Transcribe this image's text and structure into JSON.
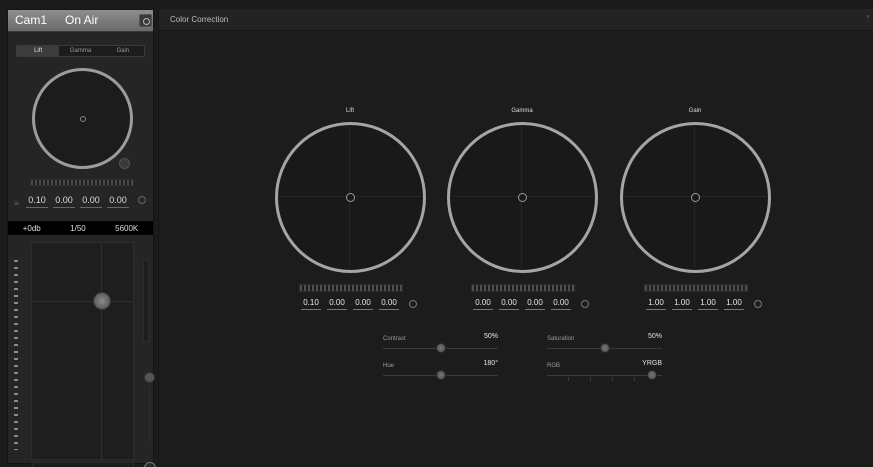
{
  "camera": {
    "name": "Cam1",
    "status": "On Air",
    "tabs": [
      "Lift",
      "Gamma",
      "Gain"
    ],
    "active_tab": "Lift",
    "lift_values": [
      "0.10",
      "0.00",
      "0.00",
      "0.00"
    ],
    "info": {
      "gain": "+0db",
      "shutter": "1/50",
      "white_balance": "5600K"
    }
  },
  "color_correction": {
    "title": "Color Correction",
    "wheels": [
      {
        "label": "Lift",
        "values": [
          "0.10",
          "0.00",
          "0.00",
          "0.00"
        ]
      },
      {
        "label": "Gamma",
        "values": [
          "0.00",
          "0.00",
          "0.00",
          "0.00"
        ]
      },
      {
        "label": "Gain",
        "values": [
          "1.00",
          "1.00",
          "1.00",
          "1.00"
        ]
      }
    ],
    "sliders": {
      "contrast": {
        "label": "Contrast",
        "value": "50%",
        "level": 0.5
      },
      "saturation": {
        "label": "Saturation",
        "value": "50%",
        "level": 0.5
      },
      "hue": {
        "label": "Hue",
        "value": "180°",
        "level": 0.5
      },
      "luma_mix": {
        "label": "RGB",
        "value": "YRGB",
        "level": 1.0
      }
    }
  }
}
